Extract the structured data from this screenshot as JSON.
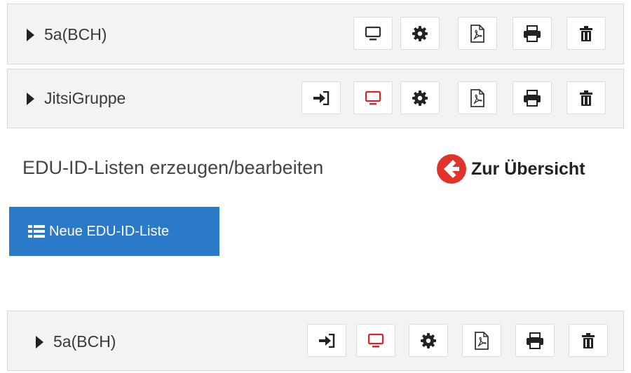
{
  "groups": [
    {
      "name": "5a(BCH)"
    },
    {
      "name": "JitsiGruppe"
    },
    {
      "name": "5a(BCH)"
    }
  ],
  "section": {
    "title": "EDU-ID-Listen erzeugen/bearbeiten",
    "back_label": "Zur Übersicht",
    "new_list_label": "Neue EDU-ID-Liste"
  },
  "colors": {
    "accent_blue": "#2b7ac9",
    "alert_red": "#e0342a",
    "monitor_active_red": "#d9252b"
  },
  "icons": {
    "caret": "caret-right-icon",
    "join": "sign-in-icon",
    "monitor": "desktop-icon",
    "settings": "cog-icon",
    "pdf": "file-pdf-icon",
    "print": "print-icon",
    "delete": "trash-icon",
    "back": "circle-arrow-left-icon",
    "list": "list-icon"
  }
}
